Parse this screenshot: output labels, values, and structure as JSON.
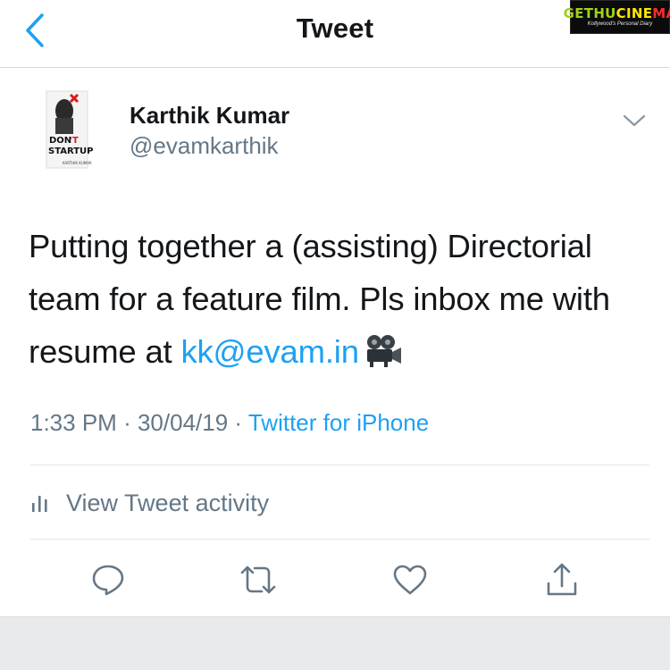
{
  "nav": {
    "title": "Tweet",
    "back_icon": "chevron-left-icon"
  },
  "watermark": {
    "brand": "GETHUCINEMA",
    "tagline": "Kollywood's Personal Diary"
  },
  "author": {
    "display_name": "Karthik Kumar",
    "handle": "@evamkarthik",
    "avatar_text": "DON'T STARTUP",
    "avatar_caption": "KARTHIK KUMAR"
  },
  "tweet": {
    "line1": "Putting together a (assisting) Directorial",
    "line2": "team for a feature film. Pls inbox me with",
    "line3_prefix": "resume at ",
    "email": "kk@evam.in",
    "emoji": "movie-camera-icon"
  },
  "meta": {
    "time": "1:33 PM",
    "separator": "·",
    "date": "30/04/19",
    "source": "Twitter for iPhone"
  },
  "activity": {
    "label": "View Tweet activity"
  },
  "actions": {
    "reply": "reply-icon",
    "retweet": "retweet-icon",
    "like": "heart-icon",
    "share": "share-icon"
  },
  "colors": {
    "link": "#1da1f2",
    "text": "#14171a",
    "secondary": "#657786",
    "divider": "#e1e8ed"
  }
}
